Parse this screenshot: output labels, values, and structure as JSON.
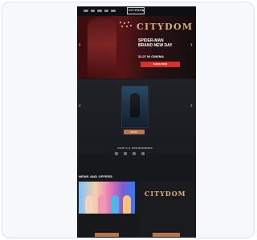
{
  "topnav": {
    "logo": "CITYDOM",
    "items": [
      "",
      "",
      "",
      "",
      ""
    ]
  },
  "hero": {
    "brand": "CITYDOM",
    "brand_sub": "",
    "headline_line1": "SPIDER-MAN",
    "headline_line2": "BRAND NEW DAY",
    "headline_line3": "31.07 IN CINEMA",
    "button": "BOOK NOW"
  },
  "movie_strip": {
    "button": "BOOK",
    "all_button": "VIEW ALL PROGRAMMES"
  },
  "section": {
    "title": "NEWS AND OFFERS"
  },
  "cards": [
    {
      "text": "",
      "button": ""
    },
    {
      "brand": "CITYDOM",
      "sub": "",
      "text": "",
      "button": ""
    }
  ],
  "colors": {
    "accent": "#b8744a",
    "gold": "#d9ae73",
    "red": "#d9322d"
  },
  "icons": [
    "chevron-left-icon",
    "chevron-right-icon",
    "social-icon"
  ]
}
